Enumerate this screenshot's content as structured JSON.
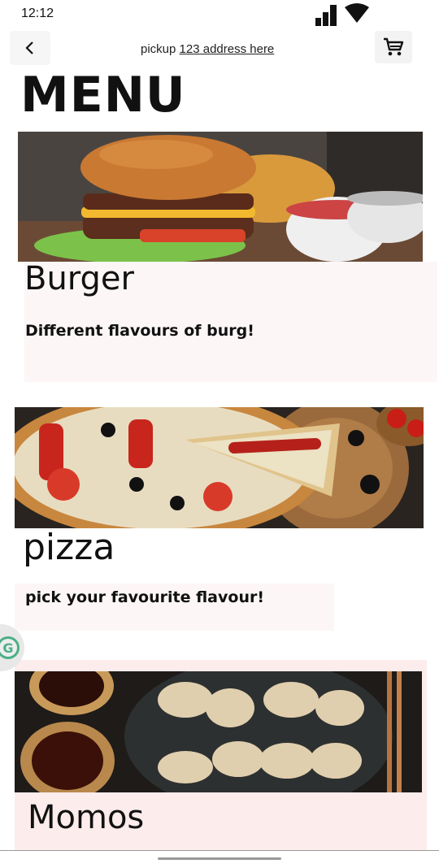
{
  "status": {
    "time": "12:12"
  },
  "header": {
    "back_icon": "chevron-left-icon",
    "pickup_label": "pickup",
    "address": "123 address here ",
    "cart_icon": "cart-icon"
  },
  "page": {
    "title": "MENU"
  },
  "items": [
    {
      "name": "Burger",
      "description": "Different flavours of burg!"
    },
    {
      "name": "pizza",
      "description": "pick your favourite flavour!"
    },
    {
      "name": "Momos",
      "description": ""
    }
  ],
  "colors": {
    "card_bg": "#fdf6f6",
    "momo_card_bg": "#fcecec"
  }
}
